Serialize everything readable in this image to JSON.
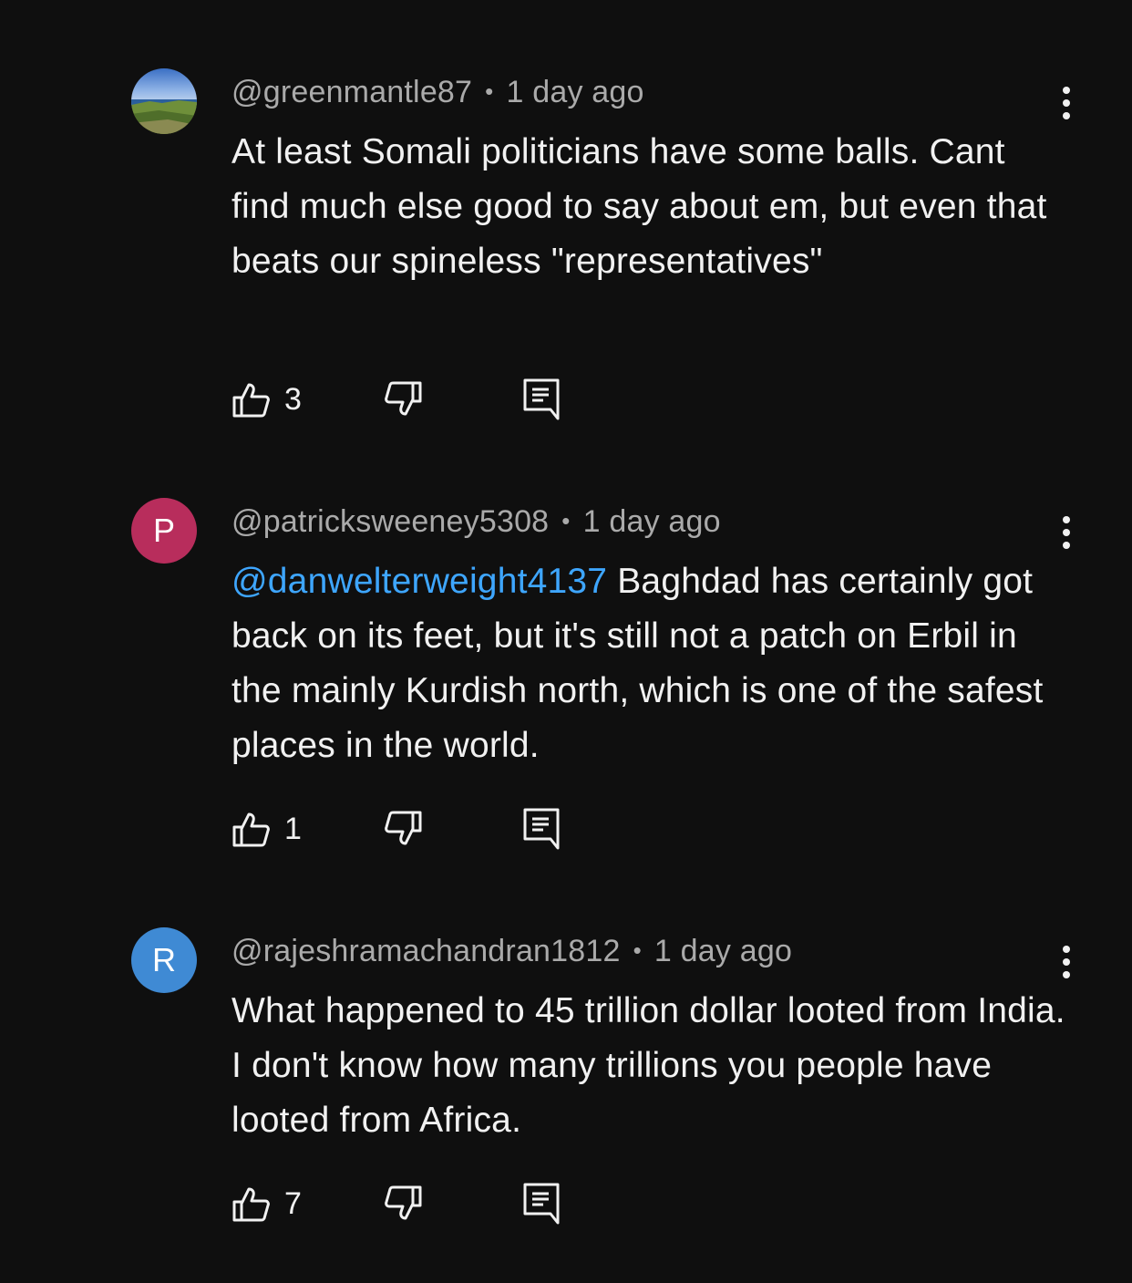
{
  "comments": [
    {
      "author": "@greenmantle87",
      "separator": "•",
      "time": "1 day ago",
      "avatar": {
        "type": "image",
        "icon": "landscape-avatar"
      },
      "mention": "",
      "text": "At least Somali politicians have some balls. Cant find much else good to say about em, but even that beats our spineless \"representatives\"",
      "likes": "3"
    },
    {
      "author": "@patricksweeney5308",
      "separator": "•",
      "time": "1 day ago",
      "avatar": {
        "type": "letter",
        "letter": "P",
        "color": "#b82d5c"
      },
      "mention": "@danwelterweight4137",
      "text": " Baghdad has certainly got back on its feet, but it's still not a patch on Erbil in the mainly Kurdish north, which is one of the safest places in the world.",
      "likes": "1"
    },
    {
      "author": "@rajeshramachandran1812",
      "separator": "•",
      "time": "1 day ago",
      "avatar": {
        "type": "letter",
        "letter": "R",
        "color": "#3f8ad4"
      },
      "mention": "",
      "text": "What happened to 45 trillion dollar looted from India. I don't know how many trillions you people have looted from Africa.",
      "likes": "7"
    }
  ],
  "icons": {
    "like": "thumbs-up-icon",
    "dislike": "thumbs-down-icon",
    "reply": "reply-comment-icon",
    "more": "more-vertical-icon"
  },
  "colors": {
    "background": "#0f0f0f",
    "text": "#f1f1f1",
    "meta": "#aaaaaa",
    "mention": "#3ea6ff"
  }
}
